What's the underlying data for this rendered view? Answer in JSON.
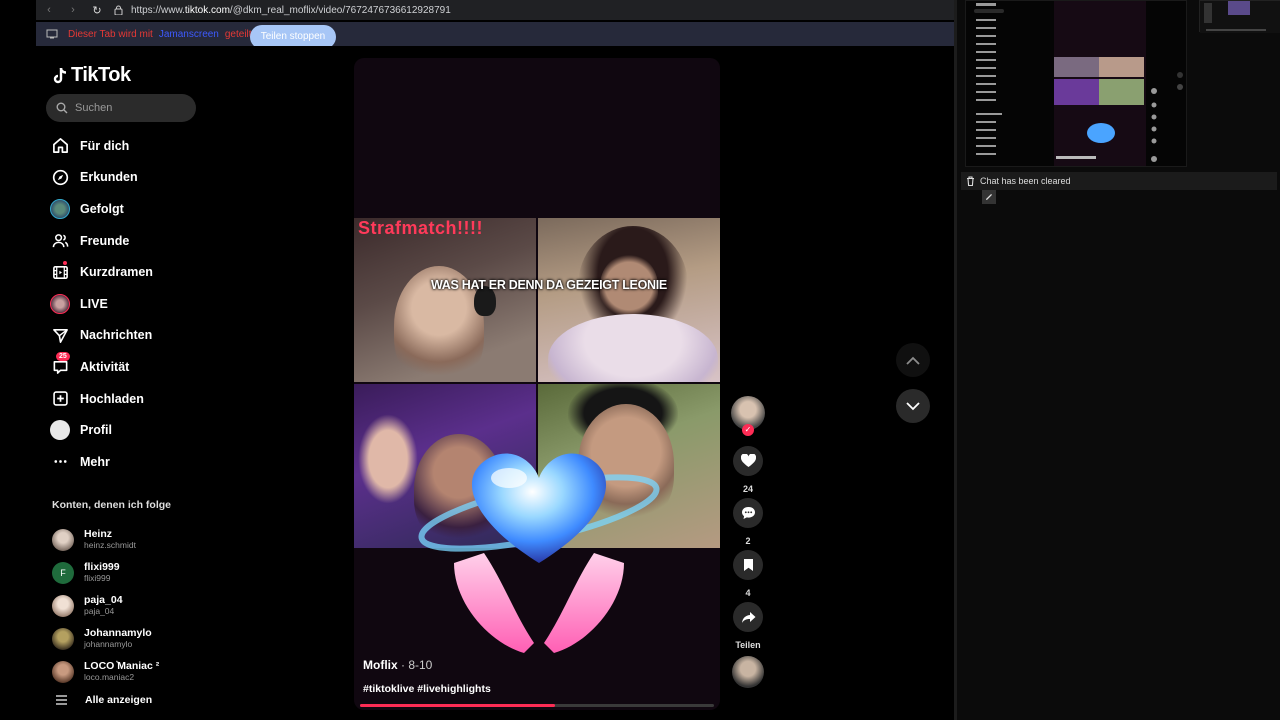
{
  "browser": {
    "url_prefix": "https://www.",
    "url_domain": "tiktok.com",
    "url_path": "/@dkm_real_moflix/video/7672476736612928791"
  },
  "share_bar": {
    "msg_part1": "Dieser Tab wird mit",
    "msg_part2": "Jamanscreen",
    "msg_part3": "geteilt",
    "stop_label": "Teilen stoppen"
  },
  "sidebar": {
    "logo": "TikTok",
    "search_placeholder": "Suchen",
    "nav": [
      {
        "label": "Für dich",
        "icon": "home-icon"
      },
      {
        "label": "Erkunden",
        "icon": "compass-icon"
      },
      {
        "label": "Gefolgt",
        "icon": "followed-avatar-icon"
      },
      {
        "label": "Freunde",
        "icon": "friends-icon"
      },
      {
        "label": "Kurzdramen",
        "icon": "film-icon"
      },
      {
        "label": "LIVE",
        "icon": "live-avatar-icon"
      },
      {
        "label": "Nachrichten",
        "icon": "send-icon"
      },
      {
        "label": "Aktivität",
        "icon": "inbox-icon",
        "badge": "25"
      },
      {
        "label": "Hochladen",
        "icon": "upload-icon"
      },
      {
        "label": "Profil",
        "icon": "profile-avatar-icon"
      },
      {
        "label": "Mehr",
        "icon": "more-icon"
      }
    ],
    "following_title": "Konten, denen ich folge",
    "following": [
      {
        "name": "Heinz",
        "handle": "heinz.schmidt",
        "color": "#a89c90"
      },
      {
        "name": "flixi999",
        "handle": "flixi999",
        "color": "#1f6b3c",
        "initial": "F"
      },
      {
        "name": "paja_04",
        "handle": "paja_04",
        "color": "#c8b4a4"
      },
      {
        "name": "Johannamylo",
        "handle": "johannamylo",
        "color": "#6a5a3a"
      },
      {
        "name": "LOCO ͛Maniac ²",
        "handle": "loco.maniac2",
        "color": "#8a6a5a"
      }
    ],
    "show_all": "Alle anzeigen"
  },
  "video": {
    "stream_title": "Strafmatch!!!!",
    "caption_overlay": "WAS HAT ER DENN DA GEZEIGT LEONIE",
    "author": "Moflix",
    "date": " · 8-10",
    "hashtags": "#tiktoklive #livehighlights",
    "progress": 0.55
  },
  "actions": {
    "likes": "24",
    "comments": "2",
    "saves": "4",
    "share_label": "Teilen"
  },
  "right_panel": {
    "chat_status": "Chat has been cleared"
  },
  "colors": {
    "accent": "#fe2c55",
    "share_button": "#a7c6f6",
    "background": "#000000"
  }
}
